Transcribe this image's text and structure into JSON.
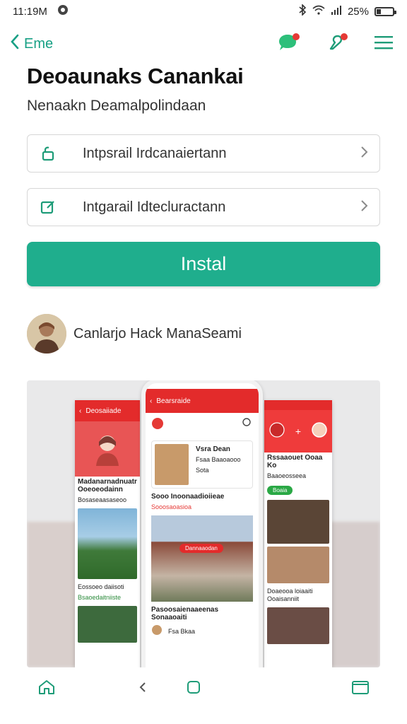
{
  "status_bar": {
    "time": "11:19M",
    "battery": "25%"
  },
  "app_bar": {
    "back_label": "Eme"
  },
  "header": {
    "title": "Deoaunaks Canankai",
    "subtitle": "Nenaakn Deamalpolindaan"
  },
  "options": [
    {
      "label": "Intpsrail Irdcanaiertann",
      "icon": "lock-icon"
    },
    {
      "label": "Intgarail Idtecluractann",
      "icon": "edit-icon"
    }
  ],
  "install": {
    "label": "Instal"
  },
  "developer": {
    "name": "Canlarjo Hack  ManaSeami"
  },
  "preview": {
    "left": {
      "bar_title": "Deosaiiade",
      "heading": "Madanarnadnuatr Ooeoeodainn",
      "meta": "Bosaseaasaseoo",
      "pill": "",
      "caption": "Eossoeo daiisoti",
      "author": "Bsaoedaitniiste"
    },
    "center": {
      "bar_title": "Bearsraide",
      "card_name": "Vsra Dean",
      "card_meta": "Fsaa Baaoaooo",
      "card_tag": "Sota",
      "section": "Sooo Inoonaadioiieae",
      "section_meta": "Sooosaoasioa",
      "banner": "Dannaaodan",
      "footer_text": "Pasoosaienaaeenas Sonaaoaiti",
      "footer_author": "Fsa Bkaa"
    },
    "right": {
      "heading": "Rssaaouet Ooaa Ko",
      "meta": "Baaoeosseea",
      "pill": "Boaia",
      "caption": "Doaeooa loiaaiti Ooaisanniit"
    }
  },
  "colors": {
    "accent": "#1fae8d",
    "brand_red": "#e32b2b",
    "badge_red": "#e53935"
  }
}
